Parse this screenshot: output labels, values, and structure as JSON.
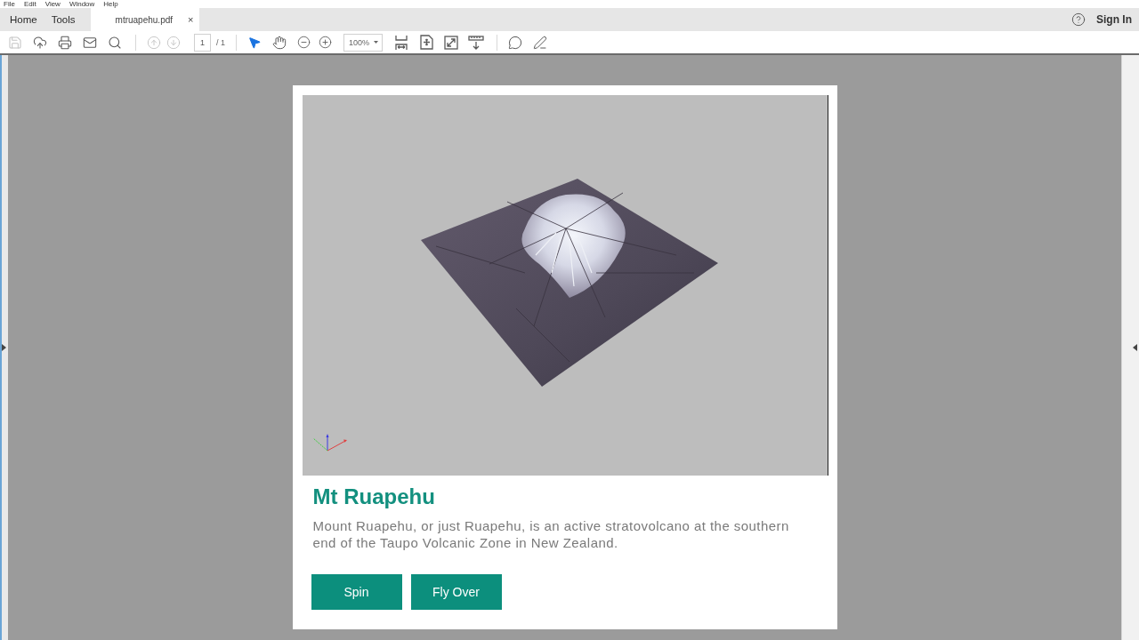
{
  "menu_bar": {
    "items": [
      "File",
      "Edit",
      "View",
      "Window",
      "Help"
    ]
  },
  "tabs": [
    {
      "kind": "nav",
      "label": "Home",
      "selected": false
    },
    {
      "kind": "nav",
      "label": "Tools",
      "selected": false
    },
    {
      "kind": "document",
      "label": "mtruapehu.pdf",
      "selected": true,
      "close": "×"
    }
  ],
  "account": {
    "label": "Sign In"
  },
  "toolbar": {
    "file_actions": [
      {
        "disabled": true
      },
      {
        "disabled": false
      },
      {
        "disabled": false
      },
      {
        "disabled": false
      },
      {
        "disabled": false
      }
    ],
    "page_nav": [
      {
        "disabled": true
      },
      {
        "disabled": true
      }
    ],
    "page_field": {
      "value": "1"
    },
    "page_count": "/ 1",
    "tools": [
      {
        "selected": true
      },
      {
        "selected": false
      }
    ],
    "zoom": {
      "value": "100%"
    }
  },
  "document": {
    "title": "Mt Ruapehu",
    "description": "Mount Ruapehu, or just Ruapehu, is an active stratovolcano at the southern end of the Taupo Volcanic Zone in New Zealand.",
    "buttons": [
      {
        "label": "Spin"
      },
      {
        "label": "Fly Over"
      }
    ]
  }
}
